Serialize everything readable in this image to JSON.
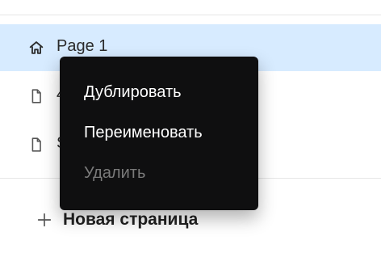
{
  "pages": [
    {
      "label": "Page 1",
      "icon": "home-icon",
      "active": true
    },
    {
      "label": "4",
      "icon": "page-icon",
      "active": false
    },
    {
      "label": "S",
      "icon": "page-icon",
      "active": false
    }
  ],
  "new_page": {
    "label": "Новая страница",
    "icon": "plus-icon"
  },
  "context_menu": {
    "items": [
      {
        "label": "Дублировать",
        "enabled": true
      },
      {
        "label": "Переименовать",
        "enabled": true
      },
      {
        "label": "Удалить",
        "enabled": false
      }
    ]
  },
  "colors": {
    "active_row_bg": "#d7ebff",
    "menu_bg": "#0f0f10",
    "menu_text": "#ffffff",
    "menu_text_disabled": "#7a7a7a",
    "divider": "#e6e6e6"
  }
}
